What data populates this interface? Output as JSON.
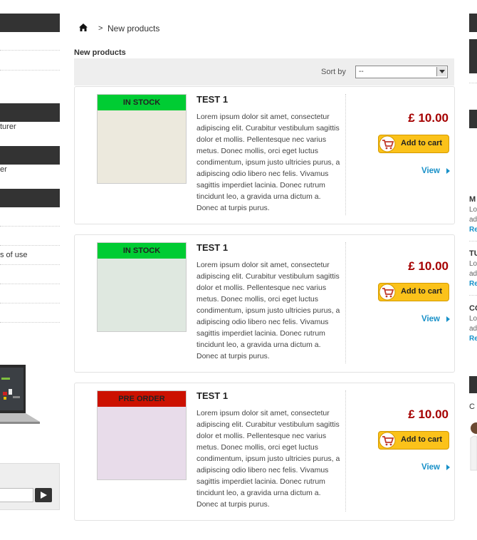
{
  "left_sidebar": {
    "items": [
      {
        "label": "turer"
      },
      {
        "label": "er"
      },
      {
        "label": "s of use"
      }
    ]
  },
  "breadcrumb": {
    "separator": ">",
    "current": "New products"
  },
  "page_title": "New products",
  "sort": {
    "label": "Sort by",
    "value": "--"
  },
  "products": [
    {
      "badge": "IN STOCK",
      "badge_color": "#00cc33",
      "image_tint": "#ece9dd",
      "name": "TEST 1",
      "description": "Lorem ipsum dolor sit amet, consectetur adipiscing elit. Curabitur vestibulum sagittis dolor et mollis. Pellentesque nec varius metus. Donec mollis, orci eget luctus condimentum, ipsum justo ultricies purus, a adipiscing odio libero nec felis. Vivamus sagittis imperdiet lacinia. Donec rutrum tincidunt leo, a gravida urna dictum a. Donec at turpis purus.",
      "price": "£ 10.00",
      "cart_label": "Add to cart",
      "view_label": "View"
    },
    {
      "badge": "IN STOCK",
      "badge_color": "#00cc33",
      "image_tint": "#dfe8e0",
      "name": "TEST 1",
      "description": "Lorem ipsum dolor sit amet, consectetur adipiscing elit. Curabitur vestibulum sagittis dolor et mollis. Pellentesque nec varius metus. Donec mollis, orci eget luctus condimentum, ipsum justo ultricies purus, a adipiscing odio libero nec felis. Vivamus sagittis imperdiet lacinia. Donec rutrum tincidunt leo, a gravida urna dictum a. Donec at turpis purus.",
      "price": "£ 10.00",
      "cart_label": "Add to cart",
      "view_label": "View"
    },
    {
      "badge": "PRE ORDER",
      "badge_color": "#cc1100",
      "image_tint": "#e8dcea",
      "name": "TEST 1",
      "description": "Lorem ipsum dolor sit amet, consectetur adipiscing elit. Curabitur vestibulum sagittis dolor et mollis. Pellentesque nec varius metus. Donec mollis, orci eget luctus condimentum, ipsum justo ultricies purus, a adipiscing odio libero nec felis. Vivamus sagittis imperdiet lacinia. Donec rutrum tincidunt leo, a gravida urna dictum a. Donec at turpis purus.",
      "price": "£ 10.00",
      "cart_label": "Add to cart",
      "view_label": "View"
    }
  ],
  "right_sidebar": {
    "items": [
      {
        "title": "M",
        "line1": "Lo",
        "line2": "ad",
        "link": "Re"
      },
      {
        "title": "TU",
        "line1": "Lo",
        "line2": "ad",
        "link": "Re"
      },
      {
        "title": "CO",
        "line1": "Lo",
        "line2": "ad",
        "link": "Re"
      }
    ],
    "partial": "C"
  },
  "colors": {
    "dark_bar": "#333333",
    "price": "#a50000",
    "link": "#1790c8",
    "cart_button": "#fbc21a"
  }
}
